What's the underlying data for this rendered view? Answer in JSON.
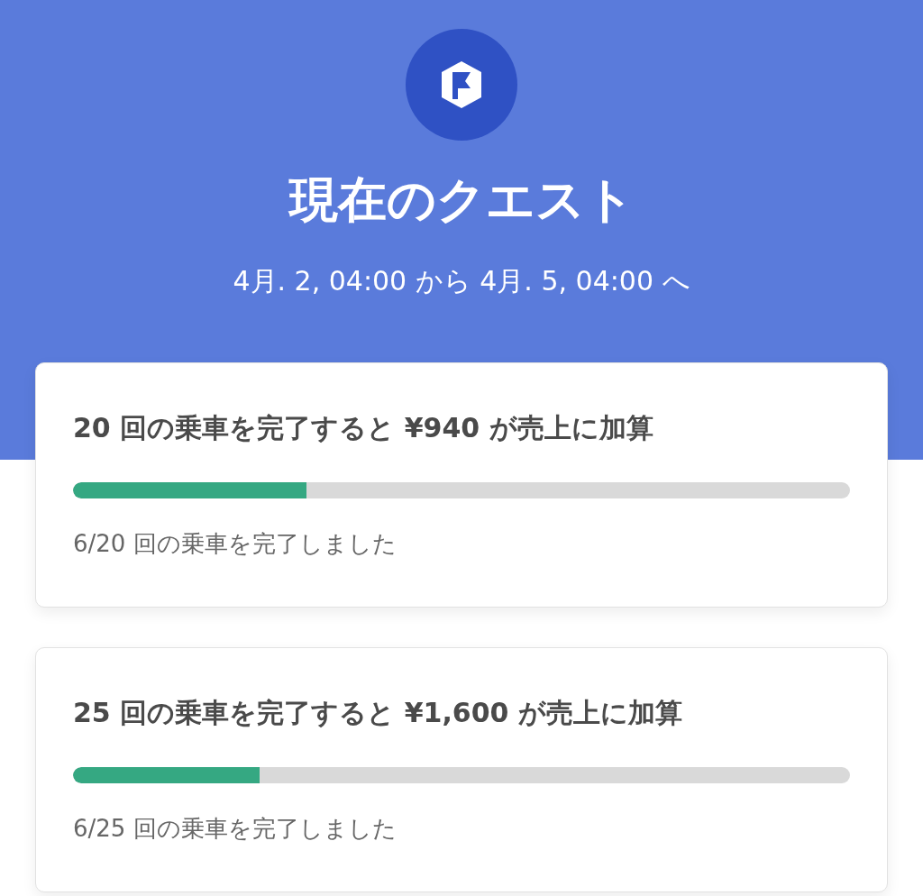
{
  "header": {
    "title": "現在のクエスト",
    "period": "4月. 2, 04:00 から 4月. 5, 04:00 へ"
  },
  "quests": [
    {
      "title": "20 回の乗車を完了すると ¥940 が売上に加算",
      "level": 0.3,
      "progress": "6/20 回の乗車を完了しました"
    },
    {
      "title": "25 回の乗車を完了すると ¥1,600 が売上に加算",
      "level": 0.24,
      "progress": "6/25 回の乗車を完了しました"
    }
  ]
}
